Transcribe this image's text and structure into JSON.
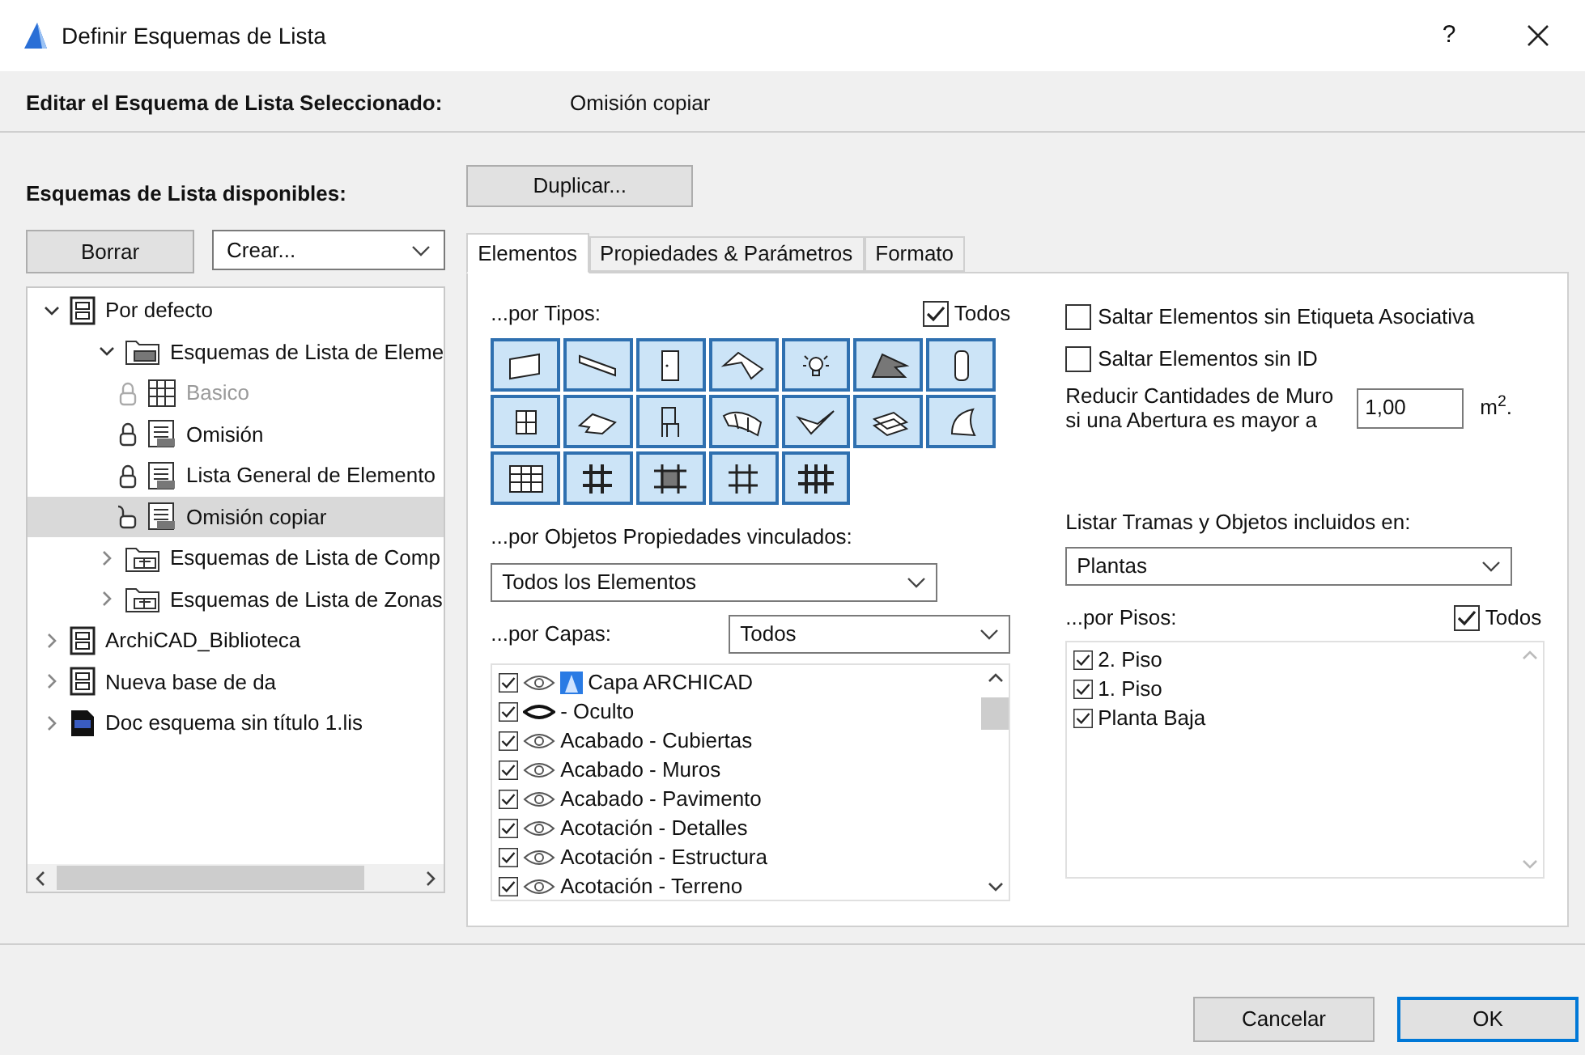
{
  "window": {
    "title": "Definir Esquemas de Lista",
    "help": "?"
  },
  "header": {
    "label": "Editar el Esquema de Lista Seleccionado:",
    "value": "Omisión copiar"
  },
  "schemes": {
    "title": "Esquemas de Lista disponibles:",
    "delete_button": "Borrar",
    "create_dropdown": "Crear...",
    "tree": [
      {
        "label": "Por defecto",
        "kind": "database",
        "expanded": true,
        "selected": false,
        "children": [
          {
            "label": "Esquemas de Lista de Eleme",
            "kind": "folder",
            "expanded": true,
            "selected": false,
            "children": [
              {
                "label": "Basico",
                "kind": "grid-scheme",
                "locked": true,
                "disabled": true,
                "selected": false
              },
              {
                "label": "Omisión",
                "kind": "list-scheme",
                "locked": true,
                "disabled": false,
                "selected": false
              },
              {
                "label": "Lista General de Elemento",
                "kind": "list-scheme",
                "locked": true,
                "disabled": false,
                "selected": false
              },
              {
                "label": "Omisión copiar",
                "kind": "list-scheme",
                "locked": false,
                "disabled": false,
                "selected": true
              }
            ]
          },
          {
            "label": "Esquemas de Lista de Comp",
            "kind": "component-folder",
            "expanded": false,
            "selected": false
          },
          {
            "label": "Esquemas de Lista de Zonas",
            "kind": "zone-folder",
            "expanded": false,
            "selected": false
          }
        ]
      },
      {
        "label": "ArchiCAD_Biblioteca",
        "kind": "database",
        "expanded": false,
        "selected": false
      },
      {
        "label": "Nueva base de da",
        "kind": "database",
        "expanded": false,
        "selected": false
      },
      {
        "label": "Doc esquema sin título 1.lis",
        "kind": "document",
        "expanded": false,
        "selected": false
      }
    ]
  },
  "duplicate_button": "Duplicar...",
  "tabs": [
    {
      "label": "Elementos",
      "selected": true
    },
    {
      "label": "Propiedades & Parámetros",
      "selected": false
    },
    {
      "label": "Formato",
      "selected": false
    }
  ],
  "by_types": {
    "label": "...por Tipos:",
    "all": {
      "label": "Todos",
      "checked": true
    },
    "types": [
      {
        "selected": true
      },
      {
        "selected": true
      },
      {
        "selected": true
      },
      {
        "selected": true
      },
      {
        "selected": true
      },
      {
        "selected": true
      },
      {
        "selected": true
      },
      {
        "selected": true
      },
      {
        "selected": true
      },
      {
        "selected": true
      },
      {
        "selected": true
      },
      {
        "selected": true
      },
      {
        "selected": true
      },
      {
        "selected": true
      },
      {
        "selected": true
      },
      {
        "selected": true
      },
      {
        "selected": true
      },
      {
        "selected": true
      },
      {
        "selected": true
      }
    ]
  },
  "skip_options": [
    {
      "label": "Saltar Elementos sin Etiqueta Asociativa",
      "checked": false
    },
    {
      "label": "Saltar Elementos sin ID",
      "checked": false
    }
  ],
  "reduce": {
    "label": "Reducir Cantidades de Muro si una Abertura es mayor a",
    "value": "1,00",
    "unit": "m$^{2}$."
  },
  "linked_props": {
    "label": "...por Objetos Propiedades vinculados:",
    "value": "Todos los Elementos"
  },
  "layers": {
    "label": "...por Capas:",
    "filter": "Todos",
    "items": [
      {
        "label": "Capa ARCHICAD",
        "checked": true,
        "visible": true,
        "kind": "archicad"
      },
      {
        "label": "- Oculto",
        "checked": true,
        "visible": false,
        "kind": "plain"
      },
      {
        "label": "Acabado - Cubiertas",
        "checked": true,
        "visible": true,
        "kind": "plain"
      },
      {
        "label": "Acabado - Muros",
        "checked": true,
        "visible": true,
        "kind": "plain"
      },
      {
        "label": "Acabado - Pavimento",
        "checked": true,
        "visible": true,
        "kind": "plain"
      },
      {
        "label": "Acotación - Detalles",
        "checked": true,
        "visible": true,
        "kind": "plain"
      },
      {
        "label": "Acotación - Estructura",
        "checked": true,
        "visible": true,
        "kind": "plain"
      },
      {
        "label": "Acotación - Terreno",
        "checked": true,
        "visible": true,
        "kind": "plain"
      }
    ]
  },
  "list_in": {
    "label": "Listar Tramas y Objetos incluidos en:",
    "value": "Plantas"
  },
  "stories": {
    "label": "...por Pisos:",
    "all": {
      "label": "Todos",
      "checked": true
    },
    "items": [
      {
        "label": "2. Piso",
        "checked": true
      },
      {
        "label": "1. Piso",
        "checked": true
      },
      {
        "label": "Planta Baja",
        "checked": true
      }
    ]
  },
  "buttons": [
    {
      "label": "Cancelar",
      "default": false
    },
    {
      "label": "OK",
      "default": true
    }
  ]
}
